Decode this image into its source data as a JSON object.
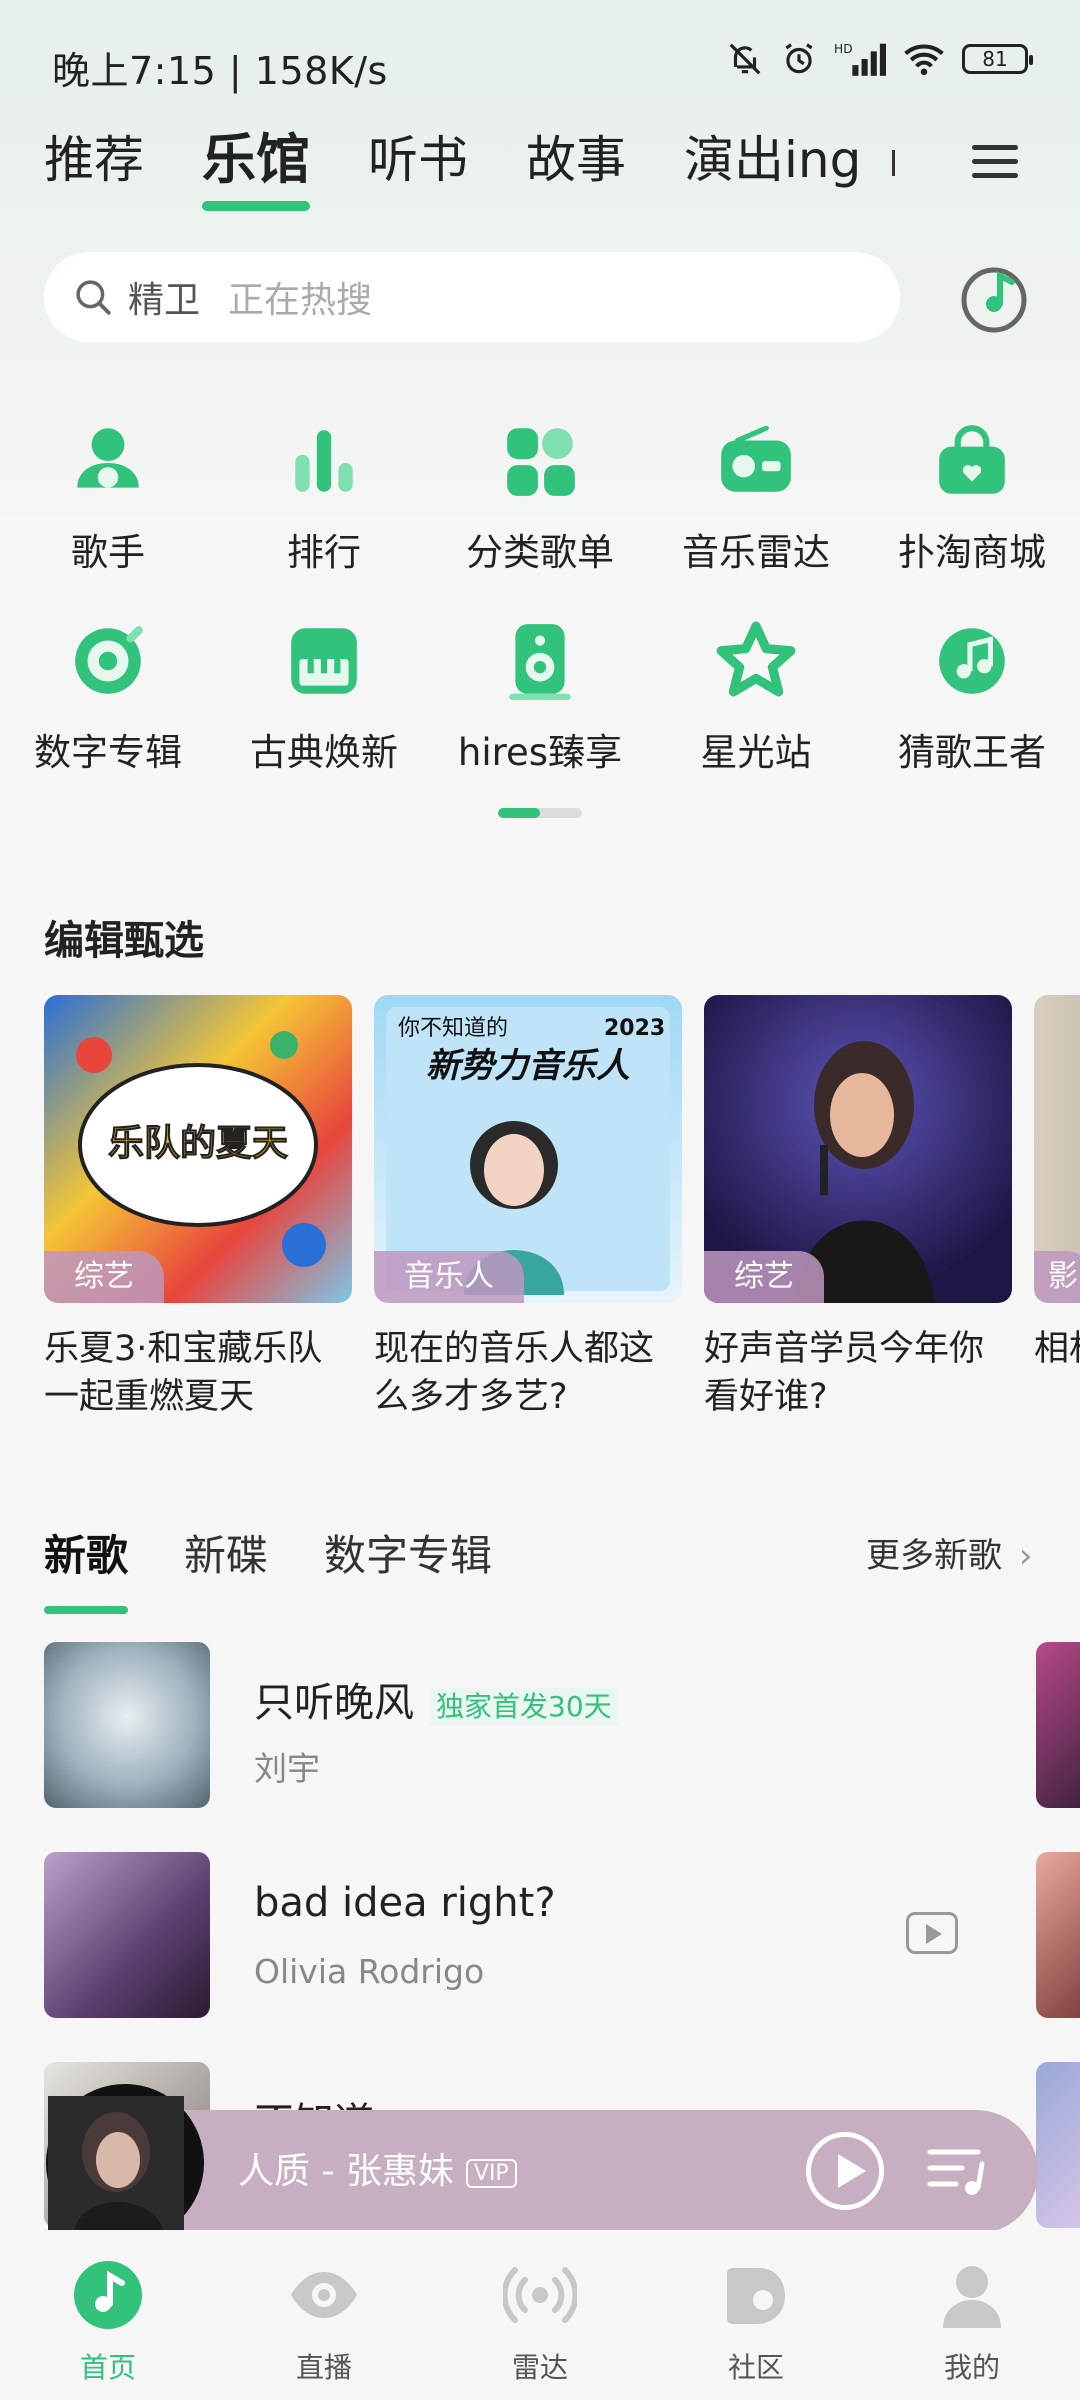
{
  "status_bar": {
    "time": "晚上7:15 | 158K/s",
    "battery": "81",
    "signal_hd": "HD"
  },
  "top_tabs": [
    {
      "label": "推荐"
    },
    {
      "label": "乐馆"
    },
    {
      "label": "听书"
    },
    {
      "label": "故事"
    },
    {
      "label": "演出ing"
    }
  ],
  "search": {
    "placeholder_main": "精卫",
    "placeholder_hot": "正在热搜"
  },
  "quick_grid": [
    {
      "label": "歌手",
      "icon": "singer-icon"
    },
    {
      "label": "排行",
      "icon": "chart-icon"
    },
    {
      "label": "分类歌单",
      "icon": "category-icon"
    },
    {
      "label": "音乐雷达",
      "icon": "radio-icon"
    },
    {
      "label": "扑淘商城",
      "icon": "shop-bag-icon"
    },
    {
      "label": "数字专辑",
      "icon": "digital-album-icon"
    },
    {
      "label": "古典焕新",
      "icon": "piano-icon"
    },
    {
      "label": "hires臻享",
      "icon": "speaker-icon"
    },
    {
      "label": "星光站",
      "icon": "star-station-icon"
    },
    {
      "label": "猜歌王者",
      "icon": "guess-song-icon"
    }
  ],
  "editor_picks": {
    "title": "编辑甄选",
    "items": [
      {
        "tag": "综艺",
        "title": "乐夏3·和宝藏乐队一起重燃夏天",
        "cover_text": "乐队的夏天"
      },
      {
        "tag": "音乐人",
        "title": "现在的音乐人都这么多才多艺?",
        "cover_text": "新势力音乐人",
        "cover_sub": "你不知道的",
        "cover_year": "2023"
      },
      {
        "tag": "综艺",
        "title": "好声音学员今年你看好谁?"
      },
      {
        "tag": "影",
        "title": "相相"
      }
    ]
  },
  "new_songs": {
    "tabs": [
      "新歌",
      "新碟",
      "数字专辑"
    ],
    "more": "更多新歌",
    "songs": [
      {
        "title": "只听晚风",
        "badge": "独家首发30天",
        "artist": "刘宇"
      },
      {
        "title": "bad idea right?",
        "artist": "Olivia Rodrigo"
      },
      {
        "title": "不知道",
        "artist": ""
      }
    ]
  },
  "player": {
    "title": "人质 - 张惠妹",
    "vip": "VIP"
  },
  "bottom_nav": [
    {
      "label": "首页"
    },
    {
      "label": "直播"
    },
    {
      "label": "雷达"
    },
    {
      "label": "社区"
    },
    {
      "label": "我的"
    }
  ],
  "colors": {
    "accent": "#31c27c",
    "player_bg": "#c7afc1",
    "tag_bg": "#be96be"
  }
}
